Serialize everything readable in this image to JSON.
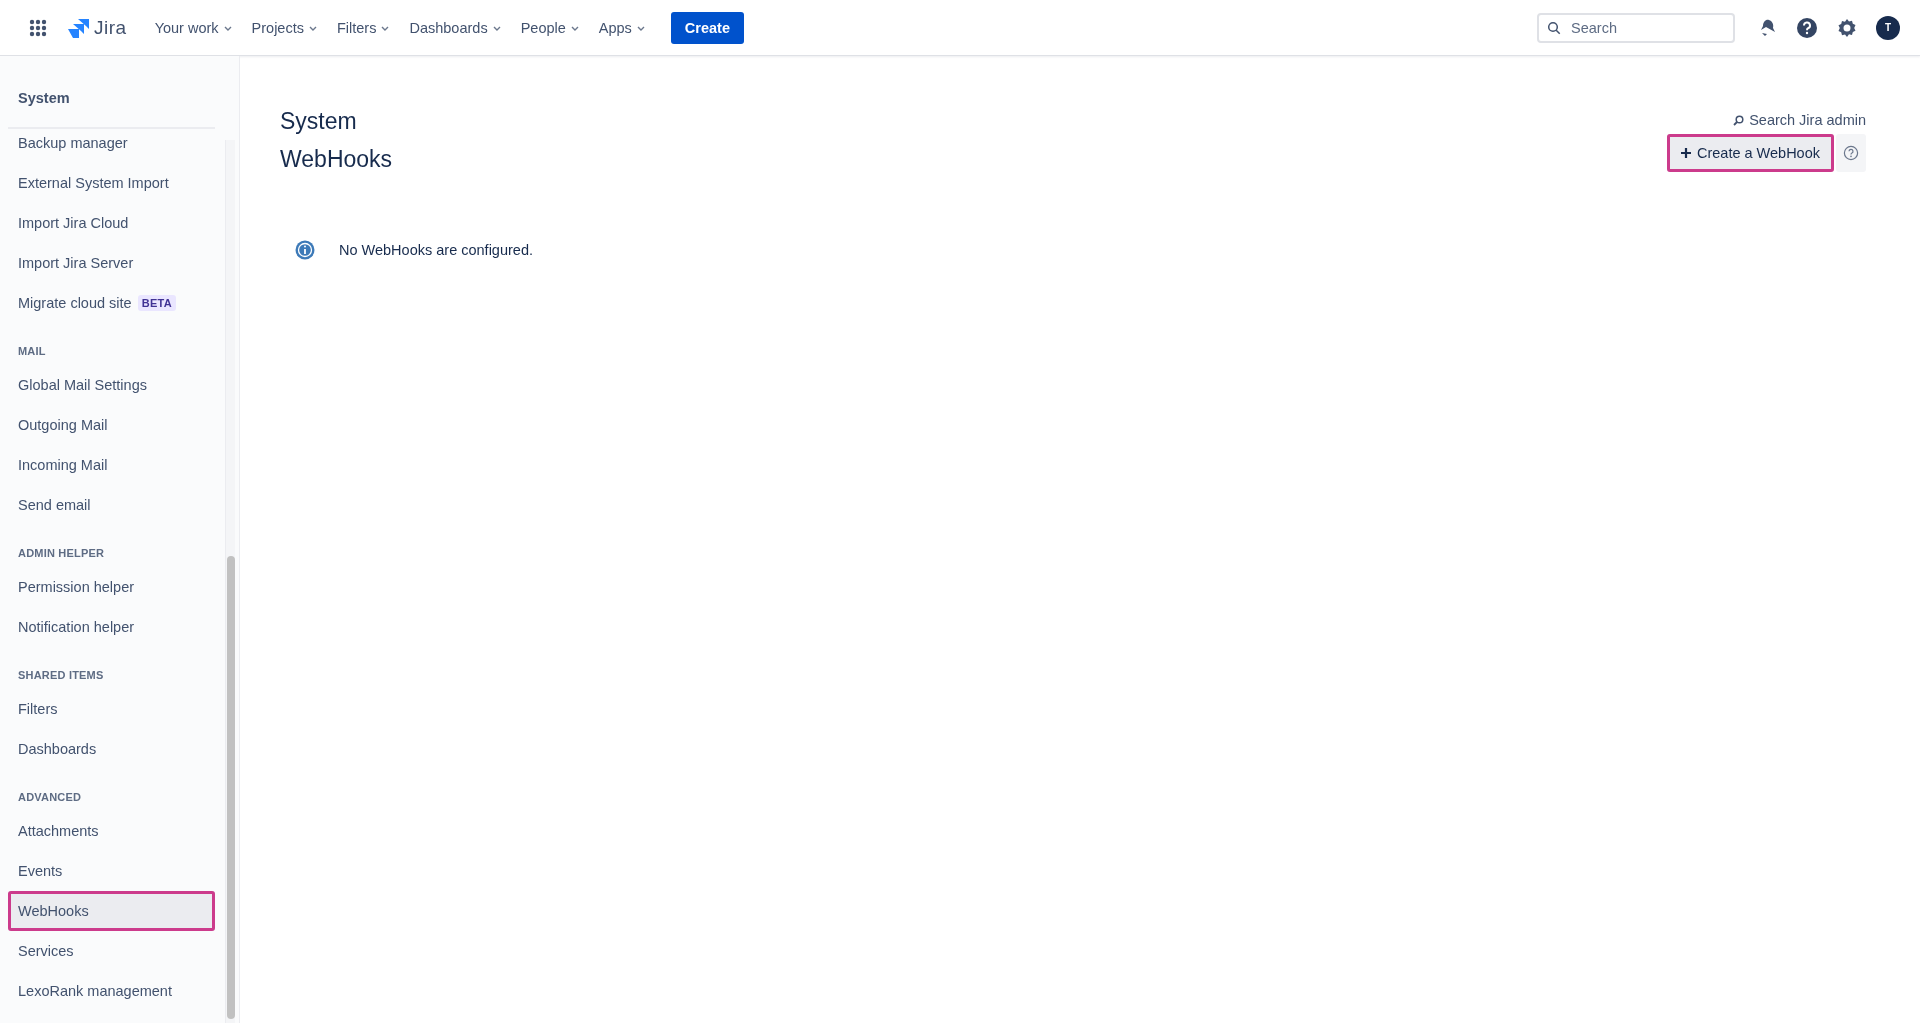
{
  "topbar": {
    "product": "Jira",
    "nav": [
      {
        "label": "Your work"
      },
      {
        "label": "Projects"
      },
      {
        "label": "Filters"
      },
      {
        "label": "Dashboards"
      },
      {
        "label": "People"
      },
      {
        "label": "Apps"
      }
    ],
    "create": "Create",
    "search": {
      "placeholder": "Search"
    },
    "avatar": "T"
  },
  "sidebar": {
    "title": "System",
    "sections": [
      {
        "items": [
          {
            "label": "Backup manager",
            "selected": false,
            "highlighted": false
          },
          {
            "label": "External System Import",
            "selected": false,
            "highlighted": false
          },
          {
            "label": "Import Jira Cloud",
            "selected": false,
            "highlighted": false
          },
          {
            "label": "Import Jira Server",
            "selected": false,
            "highlighted": false
          },
          {
            "label": "Migrate cloud site",
            "badge": "BETA",
            "selected": false,
            "highlighted": false
          }
        ]
      },
      {
        "heading": "MAIL",
        "items": [
          {
            "label": "Global Mail Settings",
            "selected": false,
            "highlighted": false
          },
          {
            "label": "Outgoing Mail",
            "selected": false,
            "highlighted": false
          },
          {
            "label": "Incoming Mail",
            "selected": false,
            "highlighted": false
          },
          {
            "label": "Send email",
            "selected": false,
            "highlighted": false
          }
        ]
      },
      {
        "heading": "ADMIN HELPER",
        "items": [
          {
            "label": "Permission helper",
            "selected": false,
            "highlighted": false
          },
          {
            "label": "Notification helper",
            "selected": false,
            "highlighted": false
          }
        ]
      },
      {
        "heading": "SHARED ITEMS",
        "items": [
          {
            "label": "Filters",
            "selected": false,
            "highlighted": false
          },
          {
            "label": "Dashboards",
            "selected": false,
            "highlighted": false
          }
        ]
      },
      {
        "heading": "ADVANCED",
        "items": [
          {
            "label": "Attachments",
            "selected": false,
            "highlighted": false
          },
          {
            "label": "Events",
            "selected": false,
            "highlighted": false
          },
          {
            "label": "WebHooks",
            "selected": true,
            "highlighted": true
          },
          {
            "label": "Services",
            "selected": false,
            "highlighted": false
          },
          {
            "label": "LexoRank management",
            "selected": false,
            "highlighted": false
          }
        ]
      }
    ]
  },
  "main": {
    "section": "System",
    "title": "WebHooks",
    "admin_search": "Search Jira admin",
    "create_button": {
      "label": "Create a WebHook",
      "highlighted": true
    },
    "message": "No WebHooks are configured."
  }
}
